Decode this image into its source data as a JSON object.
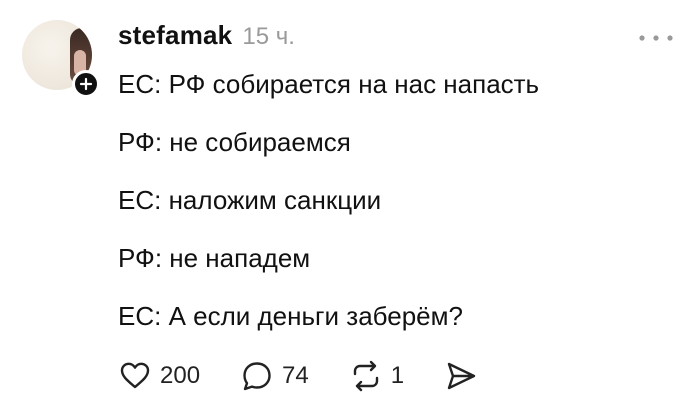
{
  "post": {
    "username": "stefamak",
    "timestamp": "15 ч.",
    "lines": [
      "ЕС: РФ собирается на нас напасть",
      "РФ: не собираемся",
      "ЕС: наложим санкции",
      "РФ: не нападем",
      "ЕС: А если деньги заберём?"
    ],
    "actions": {
      "likes": "200",
      "replies": "74",
      "reposts": "1"
    }
  },
  "icons": {
    "like": "heart-icon",
    "reply": "speech-bubble-icon",
    "repost": "repost-icon",
    "share": "send-icon",
    "more": "more-dots-icon",
    "follow": "plus-icon"
  },
  "colors": {
    "text": "#111111",
    "muted": "#9a9a9a",
    "badge": "#111111"
  }
}
